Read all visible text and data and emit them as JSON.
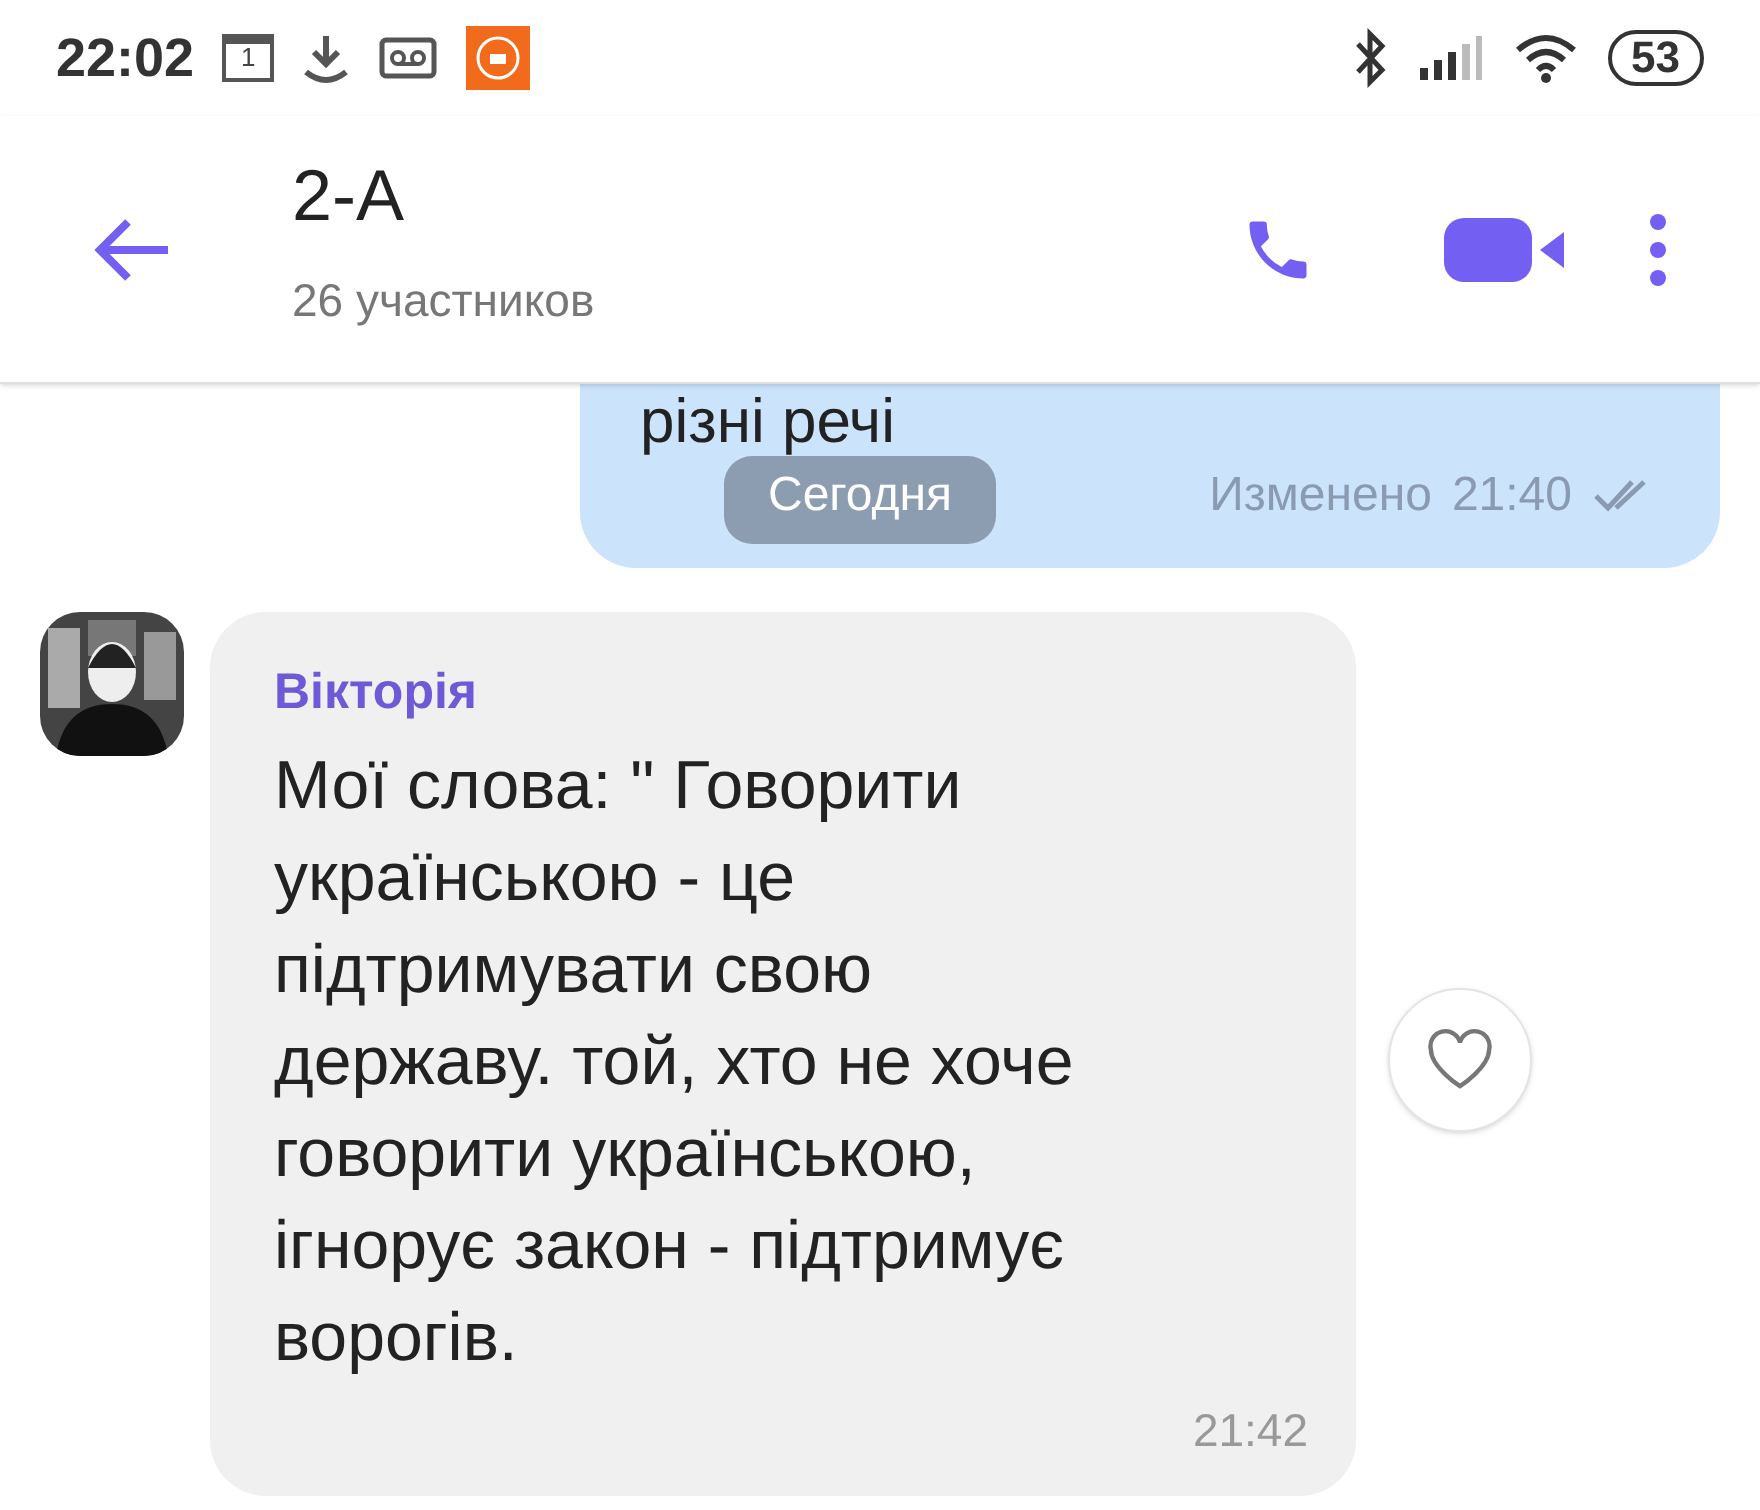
{
  "status_bar": {
    "time": "22:02",
    "calendar_day": "1",
    "battery": "53"
  },
  "header": {
    "title": "2-А",
    "subtitle": "26 участников"
  },
  "messages": [
    {
      "kind": "outgoing",
      "text": "різні речі",
      "meta": "Изменено",
      "time": "21:40",
      "read": true
    },
    {
      "kind": "date",
      "text": "Сегодня"
    },
    {
      "kind": "incoming",
      "sender": "Вікторія",
      "text": "Мої слова: \" Говорити українською - це підтримувати свою державу. той, хто не хоче говорити українською, ігнорує закон - підтримує ворогів.",
      "time": "21:42",
      "liked": false
    }
  ]
}
